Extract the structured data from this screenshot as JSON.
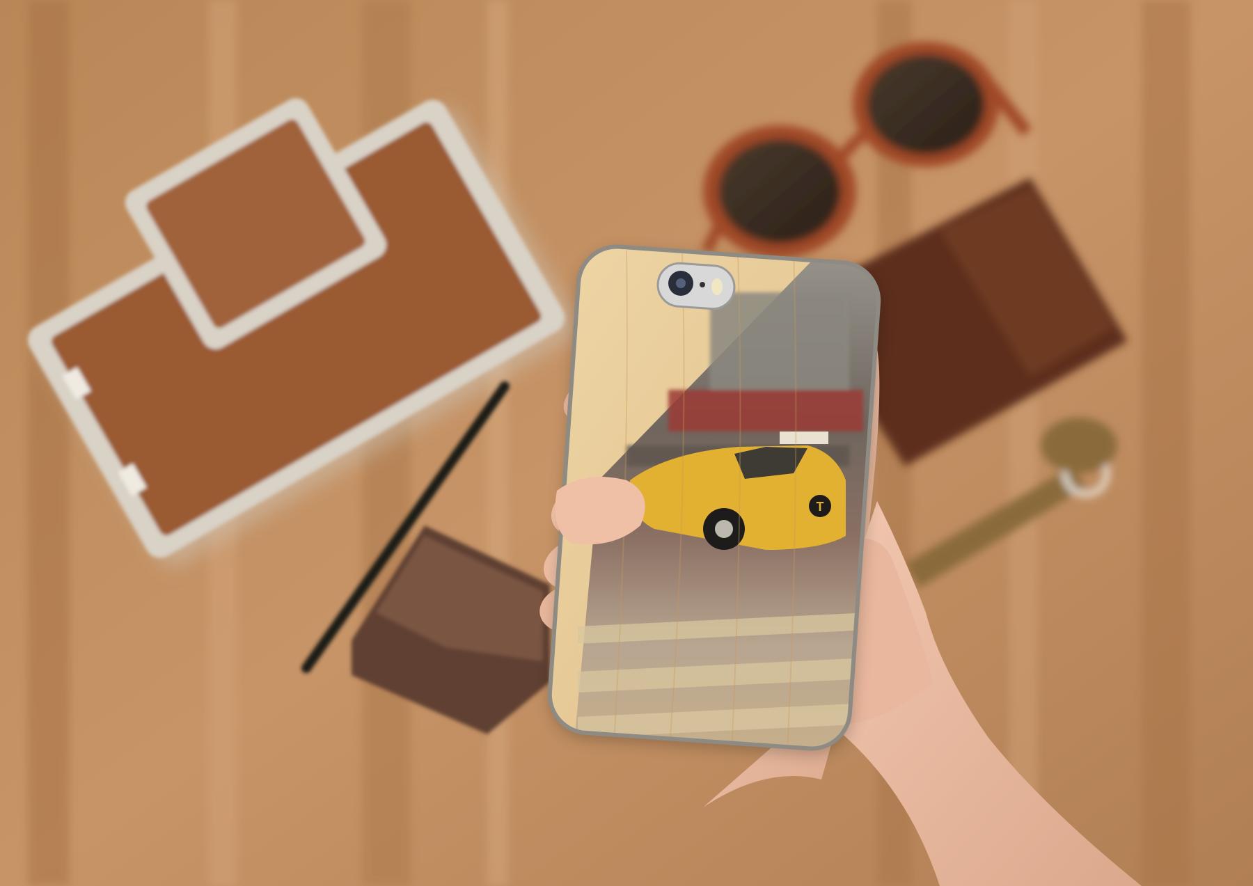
{
  "palette": {
    "table": "#c08f62",
    "table_dark": "#9c6d45",
    "leather": "#9a5a30",
    "metal": "#d9d2c6",
    "taxi": "#e2b131",
    "maple": "#e8cf9e"
  },
  "objects": {
    "taxi_marker": "T"
  }
}
